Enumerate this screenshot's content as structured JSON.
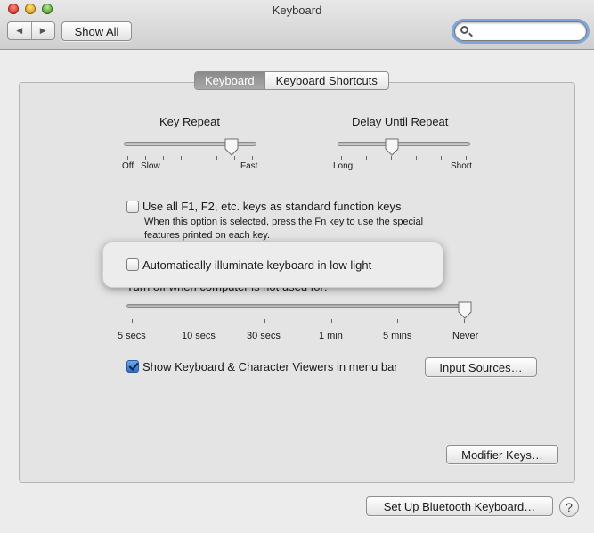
{
  "window": {
    "title": "Keyboard"
  },
  "toolbar": {
    "back_glyph": "◀",
    "forward_glyph": "▶",
    "show_all_label": "Show All",
    "search_placeholder": ""
  },
  "tabs": [
    {
      "label": "Keyboard",
      "selected": true
    },
    {
      "label": "Keyboard Shortcuts",
      "selected": false
    }
  ],
  "key_repeat": {
    "title": "Key Repeat",
    "left_label_1": "Off",
    "left_label_2": "Slow",
    "right_label": "Fast",
    "value_fraction": 0.82
  },
  "delay_until_repeat": {
    "title": "Delay Until Repeat",
    "left_label": "Long",
    "right_label": "Short",
    "value_fraction": 0.41
  },
  "function_keys": {
    "label": "Use all F1, F2, etc. keys as standard function keys",
    "help_line_1": "When this option is selected, press the Fn key to use the special",
    "help_line_2": "features printed on each key.",
    "checked": false
  },
  "illuminate": {
    "label": "Automatically illuminate keyboard in low light",
    "checked": false
  },
  "turn_off": {
    "partial_label": "Turn off when computer is not used for:",
    "ticks": [
      "5 secs",
      "10 secs",
      "30 secs",
      "1 min",
      "5 mins",
      "Never"
    ],
    "selected": "Never"
  },
  "viewers": {
    "label": "Show Keyboard & Character Viewers in menu bar",
    "checked": true
  },
  "buttons": {
    "input_sources": "Input Sources…",
    "modifier_keys": "Modifier Keys…",
    "bluetooth": "Set Up Bluetooth Keyboard…",
    "help": "?"
  },
  "colors": {
    "accent": "#2e6cc9",
    "focus_ring": "#7ea6db"
  }
}
